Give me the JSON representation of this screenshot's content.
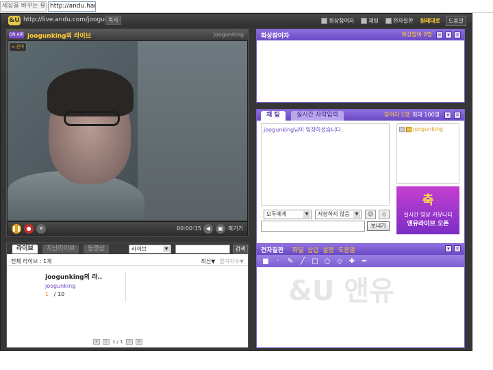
{
  "browser": {
    "ticker": "세상을 바꾸는 유",
    "url_input": "http://andu.hana"
  },
  "header": {
    "logo": "&U",
    "url": "http://live.andu.com/joogunking",
    "copy_label": "복사",
    "menu": [
      "화상참여자",
      "채팅",
      "전자칠판",
      "원래대로",
      "도움말"
    ]
  },
  "live": {
    "onair_label": "ON AIR",
    "title": "joogunking의 라이브",
    "owner": "joogunking",
    "video_badge": "∞ 끈이",
    "time": "00:00:15",
    "popout_label": "펴기기"
  },
  "participants": {
    "title": "화상참여자",
    "count_label": "화상참여 0명"
  },
  "chat": {
    "tab_chat": "채 팅",
    "tab_caption": "실시간 자막입력",
    "count_label": "참여자 1명",
    "max_label": "최대 100명",
    "messages": [
      "joogunking님이 입장하셨습니다."
    ],
    "users": [
      "joogunking"
    ],
    "to_select": "모두에게",
    "save_select": "저장하지 않음",
    "send_label": "보내기",
    "ad": {
      "big": "축",
      "line1": "실시간 영상 커뮤니티",
      "line2": "앤유라이브 오픈"
    }
  },
  "board": {
    "title": "전자칠판",
    "menu": [
      "파일",
      "삽입",
      "설정",
      "도움말"
    ],
    "watermark": "&U 앤유"
  },
  "list": {
    "tabs": [
      "라이브",
      "지난라이브",
      "동영상"
    ],
    "category_select": "라이브",
    "search_label": "검색",
    "total_label": "전체 라이브 : 1개",
    "sort_recent": "최신▼",
    "sort_viewers": "참여자수▼",
    "card": {
      "name": "joogunking의 라..",
      "owner": "joogunking",
      "viewers": "1",
      "max": "/ 10"
    },
    "pager": "1 / 1"
  }
}
